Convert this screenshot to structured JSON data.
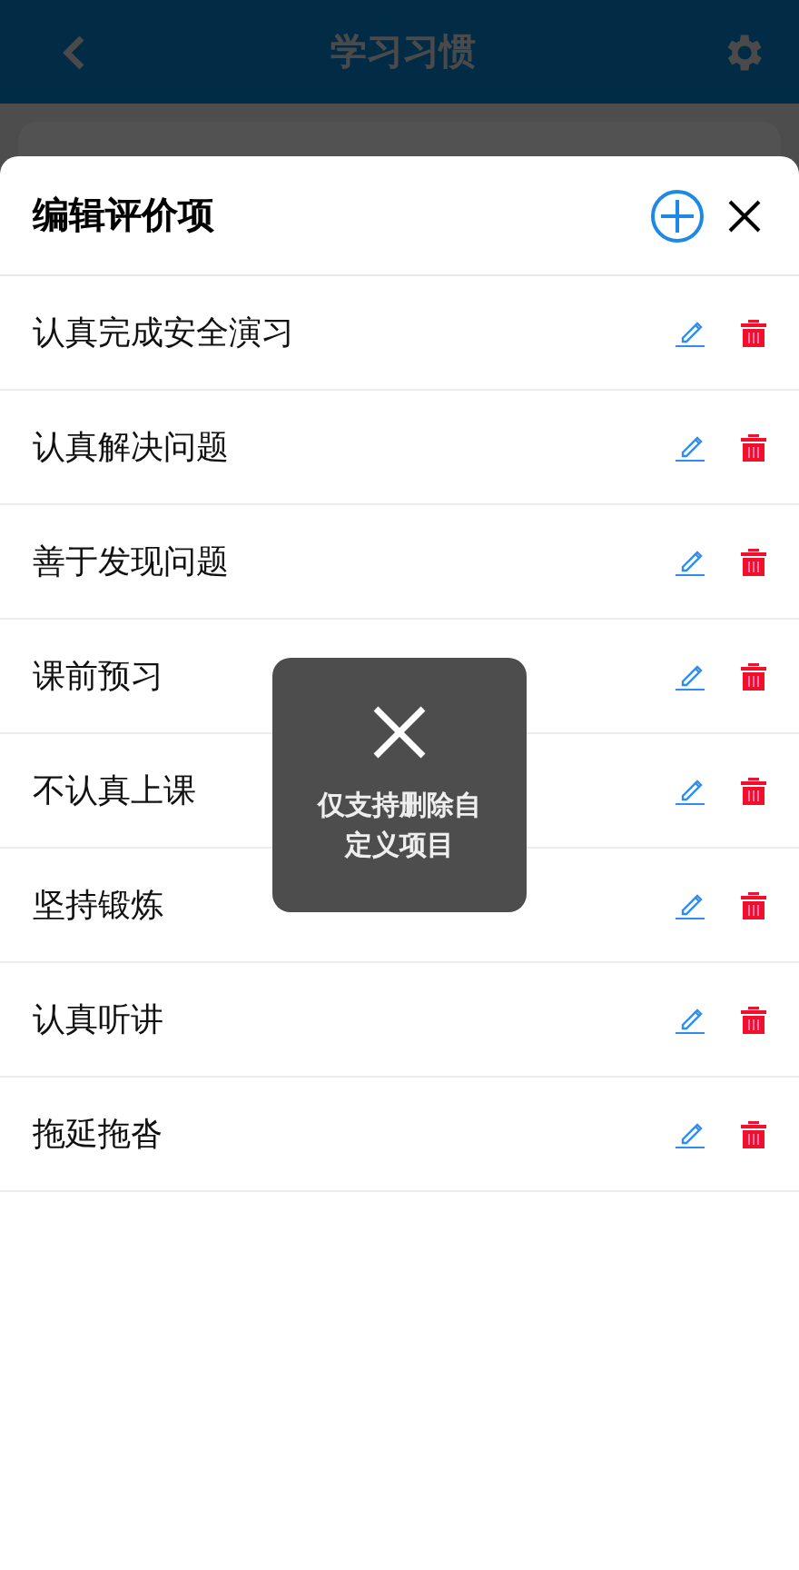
{
  "header": {
    "title": "学习习惯"
  },
  "sheet": {
    "title": "编辑评价项",
    "items": [
      {
        "label": "认真完成安全演习"
      },
      {
        "label": "认真解决问题"
      },
      {
        "label": "善于发现问题"
      },
      {
        "label": "课前预习"
      },
      {
        "label": "不认真上课"
      },
      {
        "label": "坚持锻炼"
      },
      {
        "label": "认真听讲"
      },
      {
        "label": "拖延拖沓"
      }
    ]
  },
  "toast": {
    "message": "仅支持删除自定义项目"
  }
}
